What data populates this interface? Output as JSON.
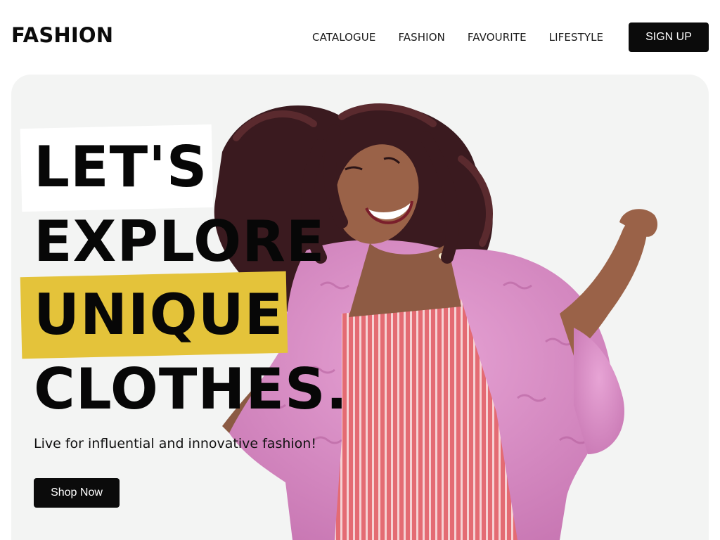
{
  "header": {
    "brand": "FASHION",
    "nav": [
      "CATALOGUE",
      "FASHION",
      "FAVOURITE",
      "LIFESTYLE"
    ],
    "signup_label": "SIGN UP"
  },
  "hero": {
    "headline": [
      "LET'S",
      "EXPLORE",
      "UNIQUE",
      "CLOTHES."
    ],
    "subtitle": "Live for influential and innovative fashion!",
    "cta_label": "Shop Now",
    "image": "smiling-woman-pink-fur-coat"
  },
  "colors": {
    "accent_yellow": "#e4c33a",
    "hero_background": "#f3f4f3",
    "coat_pink": "#d98bc4",
    "dress_red": "#e0606a",
    "button_black": "#0b0b0b"
  }
}
